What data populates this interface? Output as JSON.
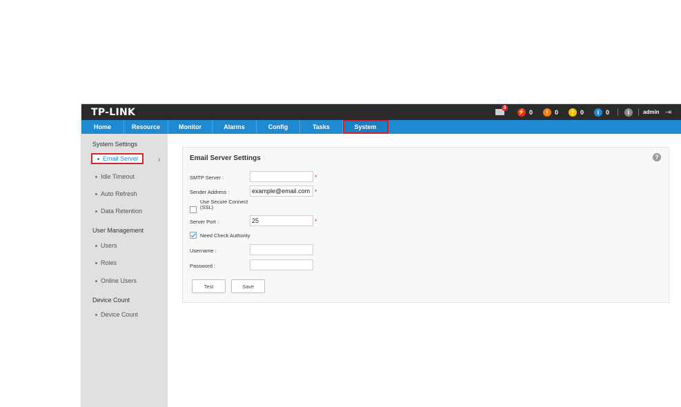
{
  "header": {
    "logo": "TP-LINK",
    "mail_badge": "3",
    "alerts": [
      {
        "icon": "critical",
        "color": "#e52d27",
        "symbol": "⚡",
        "count": "0"
      },
      {
        "icon": "major",
        "color": "#f07d12",
        "symbol": "!",
        "count": "0"
      },
      {
        "icon": "minor",
        "color": "#f2c200",
        "symbol": "!",
        "count": "0"
      },
      {
        "icon": "info",
        "color": "#1f8ad2",
        "symbol": "i",
        "count": "0"
      }
    ],
    "about_symbol": "i",
    "user": "admin",
    "logout_symbol": "⇥"
  },
  "nav": {
    "tabs": [
      "Home",
      "Resource",
      "Monitor",
      "Alarms",
      "Config",
      "Tasks",
      "System"
    ],
    "active": "System"
  },
  "sidebar": {
    "groups": [
      {
        "title": "System Settings",
        "items": [
          "Email Server",
          "Idle Timeout",
          "Auto Refresh",
          "Data Retention"
        ]
      },
      {
        "title": "User Management",
        "items": [
          "Users",
          "Roles",
          "Online Users"
        ]
      },
      {
        "title": "Device Count",
        "items": [
          "Device Count"
        ]
      }
    ],
    "active_item": "Email Server",
    "chevron": "›"
  },
  "form": {
    "title": "Email Server Settings",
    "help_symbol": "?",
    "smtp_label": "SMTP Server :",
    "smtp_value": "",
    "sender_label": "Sender Address :",
    "sender_value": "example@email.com",
    "ssl_label_1": "Use Secure Connect",
    "ssl_label_2": "(SSL)",
    "ssl_checked": false,
    "port_label": "Server Port :",
    "port_value": "25",
    "auth_label": "Need Check Authority",
    "auth_checked": true,
    "username_label": "Username :",
    "username_value": "",
    "password_label": "Password :",
    "password_value": "",
    "required_mark": "*",
    "test_label": "Test",
    "save_label": "Save"
  },
  "colors": {
    "topbar": "#2b2b2b",
    "nav": "#1f8ad2",
    "highlight": "#d3232a",
    "sidebar": "#e0e0e0"
  }
}
